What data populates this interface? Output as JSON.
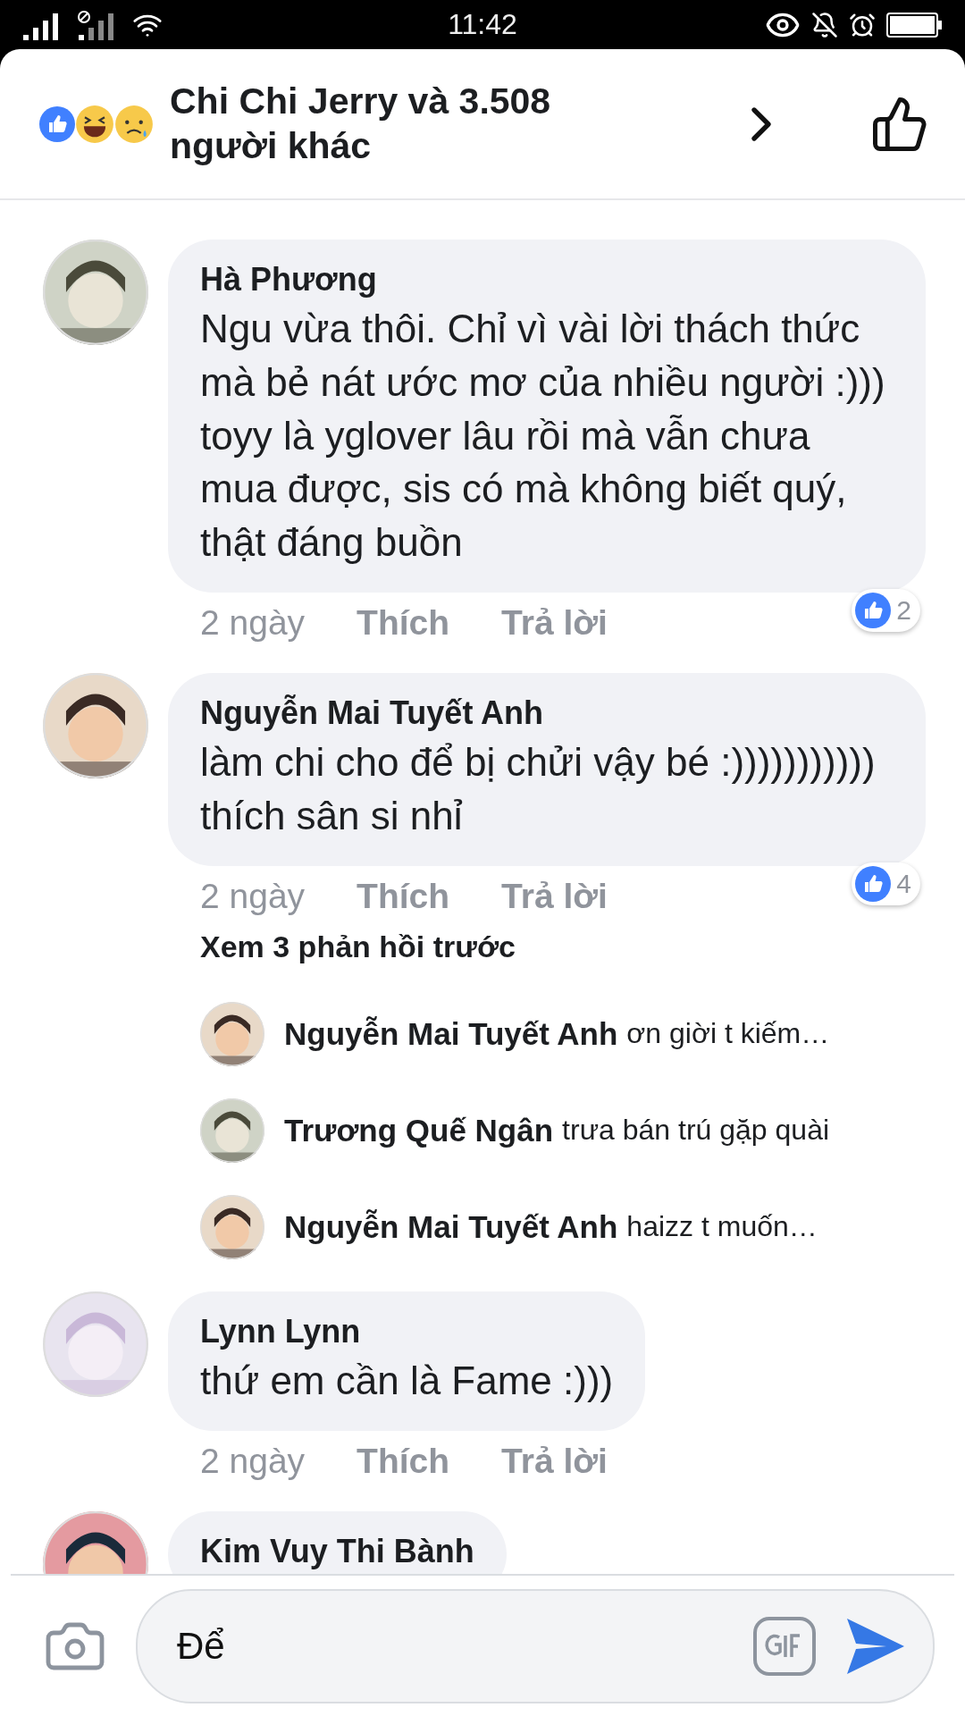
{
  "status_bar": {
    "time": "11:42"
  },
  "header": {
    "title": "Chi Chi Jerry và 3.508 người khác"
  },
  "comments": [
    {
      "author": "Hà Phương",
      "text": "Ngu vừa thôi. Chỉ vì vài lời thách thức mà bẻ nát ước mơ của nhiều người :))) toyy là yglover lâu rồi mà vẫn chưa mua được, sis có mà không biết quý, thật đáng buồn",
      "reactions": "2",
      "time": "2 ngày",
      "like": "Thích",
      "reply": "Trả lời"
    },
    {
      "author": "Nguyễn Mai Tuyết Anh",
      "text": "làm chi cho để bị chửi vậy bé :))))))))))) thích sân si nhỉ",
      "reactions": "4",
      "time": "2 ngày",
      "like": "Thích",
      "reply": "Trả lời",
      "replies": {
        "more": "Xem 3 phản hồi trước",
        "items": [
          {
            "author": "Nguyễn Mai Tuyết Anh",
            "text": "ơn giời t kiếm…"
          },
          {
            "author": "Trương Quế Ngân",
            "text": "trưa bán trú gặp quài"
          },
          {
            "author": "Nguyễn Mai Tuyết Anh",
            "text": "haizz t muốn…"
          }
        ]
      }
    },
    {
      "author": "Lynn Lynn",
      "text": "thứ em cần là Fame :)))",
      "time": "2 ngày",
      "like": "Thích",
      "reply": "Trả lời"
    },
    {
      "author": "Kim Vuy Thi Bành"
    }
  ],
  "composer": {
    "value": "Để"
  }
}
